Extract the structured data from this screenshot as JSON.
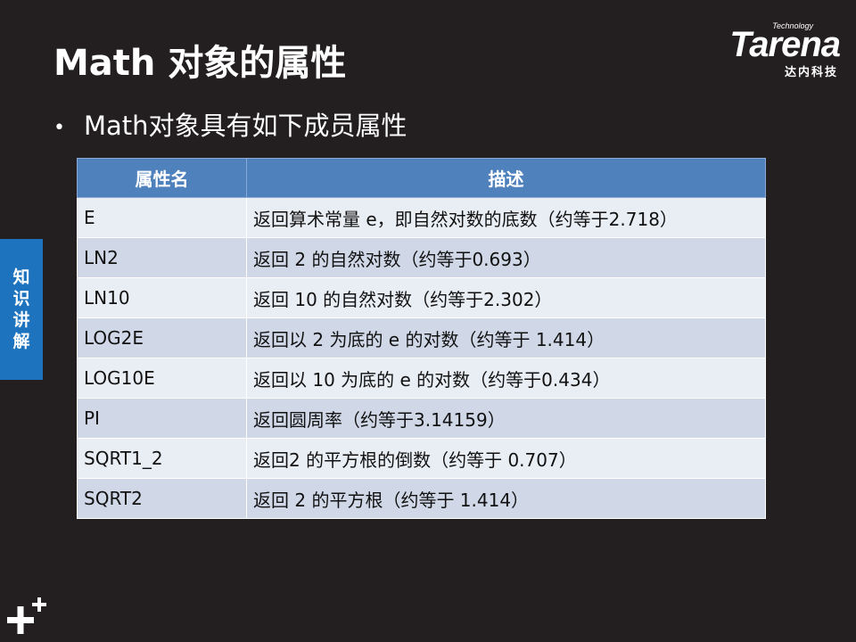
{
  "slide": {
    "title": "Math 对象的属性",
    "bullet": "Math对象具有如下成员属性",
    "side_tab": [
      "知",
      "识",
      "讲",
      "解"
    ]
  },
  "logo": {
    "tagline": "Technology",
    "brand": "Tarena",
    "cn": "达内科技"
  },
  "table": {
    "headers": [
      "属性名",
      "描述"
    ],
    "rows": [
      {
        "name": "E",
        "desc": "返回算术常量 e，即自然对数的底数（约等于2.718）"
      },
      {
        "name": "LN2",
        "desc": "返回 2 的自然对数（约等于0.693）"
      },
      {
        "name": "LN10",
        "desc": "返回 10 的自然对数（约等于2.302）"
      },
      {
        "name": "LOG2E",
        "desc": "返回以 2 为底的 e 的对数（约等于 1.414）"
      },
      {
        "name": "LOG10E",
        "desc": "返回以 10 为底的 e 的对数（约等于0.434）"
      },
      {
        "name": "PI",
        "desc": "返回圆周率（约等于3.14159）"
      },
      {
        "name": "SQRT1_2",
        "desc": "返回2 的平方根的倒数（约等于 0.707）"
      },
      {
        "name": "SQRT2",
        "desc": "返回 2 的平方根（约等于 1.414）"
      }
    ]
  },
  "colors": {
    "background": "#231f20",
    "header": "#4f81bd",
    "row_light": "#e9edf4",
    "row_dark": "#d0d8e8",
    "side_tab": "#1e73be"
  }
}
